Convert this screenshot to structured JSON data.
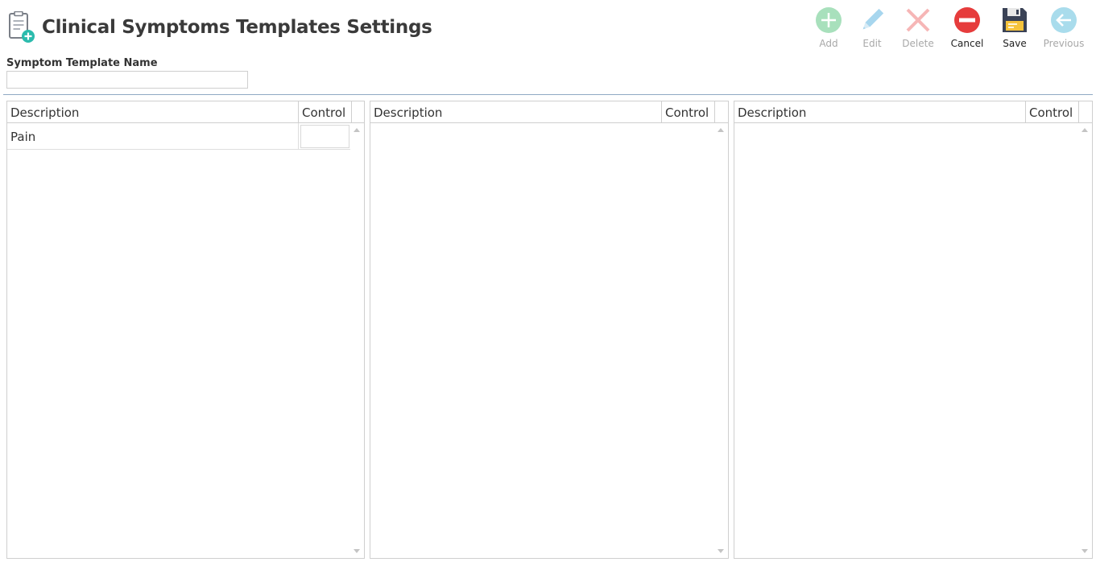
{
  "header": {
    "title": "Clinical Symptoms Templates Settings"
  },
  "toolbar": {
    "add": {
      "label": "Add",
      "icon": "add-icon",
      "enabled": false,
      "color": "#a8e0bc"
    },
    "edit": {
      "label": "Edit",
      "icon": "pencil-icon",
      "enabled": false,
      "color": "#a7d6ee"
    },
    "delete": {
      "label": "Delete",
      "icon": "delete-x-icon",
      "enabled": false,
      "color": "#f6b6b6"
    },
    "cancel": {
      "label": "Cancel",
      "icon": "cancel-icon",
      "enabled": true,
      "color": "#e63c3c"
    },
    "save": {
      "label": "Save",
      "icon": "floppy-disk-icon",
      "enabled": true,
      "color": "#3a4256"
    },
    "previous": {
      "label": "Previous",
      "icon": "arrow-left-icon",
      "enabled": false,
      "color": "#a9dcec"
    }
  },
  "form": {
    "template_name_label": "Symptom Template Name",
    "template_name_value": "",
    "template_name_placeholder": ""
  },
  "grids": [
    {
      "columns": {
        "description": "Description",
        "control": "Control"
      },
      "rows": [
        {
          "description": "Pain",
          "control": ""
        }
      ]
    },
    {
      "columns": {
        "description": "Description",
        "control": "Control"
      },
      "rows": []
    },
    {
      "columns": {
        "description": "Description",
        "control": "Control"
      },
      "rows": []
    }
  ],
  "colors": {
    "divider": "#8fa9c4",
    "border": "#cfcfcf",
    "icon_accent": "#2bbbad"
  }
}
